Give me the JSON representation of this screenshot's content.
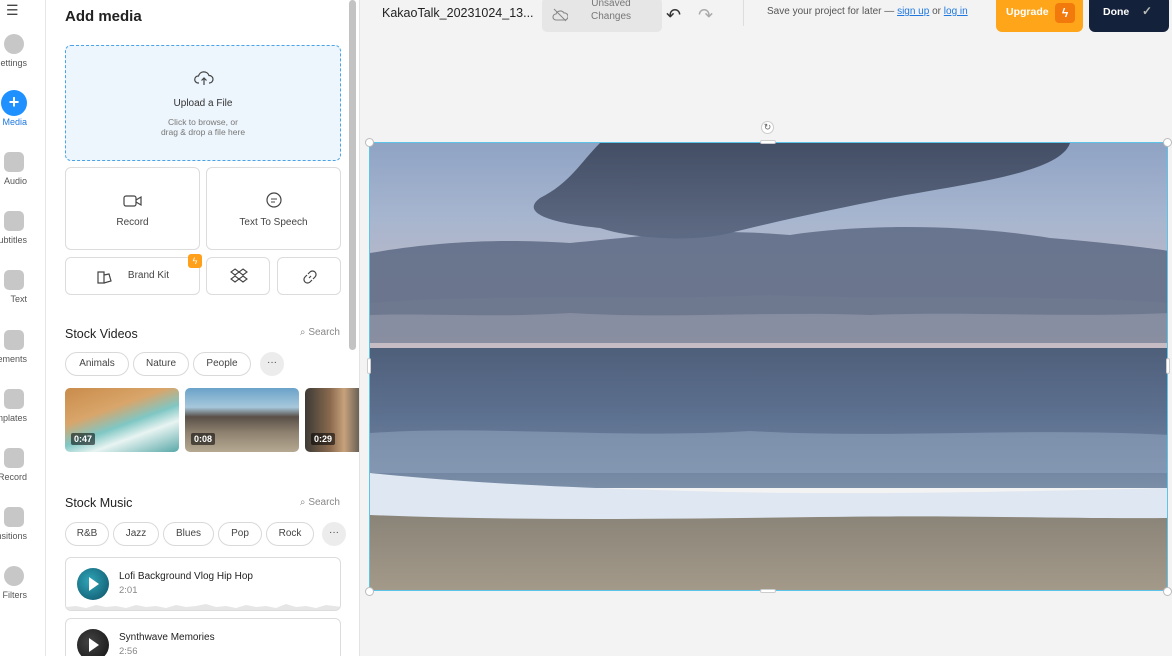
{
  "rail": {
    "items": [
      {
        "label": "ettings",
        "icon": "gear-icon"
      },
      {
        "label": "Media",
        "icon": "plus-icon",
        "active": true
      },
      {
        "label": "Audio",
        "icon": "music-note-icon"
      },
      {
        "label": "ubtitles",
        "icon": "subtitles-icon"
      },
      {
        "label": "Text",
        "icon": "text-icon"
      },
      {
        "label": "lements",
        "icon": "shapes-icon"
      },
      {
        "label": "mplates",
        "icon": "templates-icon"
      },
      {
        "label": "Record",
        "icon": "record-icon"
      },
      {
        "label": "ansitions",
        "icon": "transitions-icon"
      },
      {
        "label": "Filters",
        "icon": "filter-icon"
      }
    ]
  },
  "panel": {
    "title": "Add media",
    "upload": {
      "title": "Upload a File",
      "hint_line1": "Click to browse, or",
      "hint_line2": "drag & drop a file here"
    },
    "record_label": "Record",
    "tts_label": "Text To Speech",
    "brand_kit_label": "Brand Kit",
    "stock_videos": {
      "title": "Stock Videos",
      "search_label": "Search",
      "chips": [
        "Animals",
        "Nature",
        "People"
      ],
      "more": "···",
      "durations": [
        "0:47",
        "0:08",
        "0:29"
      ]
    },
    "stock_music": {
      "title": "Stock Music",
      "search_label": "Search",
      "chips": [
        "R&B",
        "Jazz",
        "Blues",
        "Pop",
        "Rock"
      ],
      "more": "···",
      "tracks": [
        {
          "name": "Lofi Background Vlog Hip Hop",
          "duration": "2:01"
        },
        {
          "name": "Synthwave Memories",
          "duration": "2:56"
        }
      ]
    }
  },
  "topbar": {
    "filename": "KakaoTalk_20231024_13...",
    "unsaved_line1": "Unsaved",
    "unsaved_line2": "Changes",
    "save_prefix": "Save your project for later —",
    "sign_up": "sign up",
    "or": "or",
    "log_in": "log in",
    "upgrade_label": "Upgrade",
    "done_label": "Done"
  },
  "colors": {
    "accent": "#1e90ff",
    "upgrade": "#ffa51a",
    "done": "#14213a",
    "selection": "#5bc4e8"
  }
}
